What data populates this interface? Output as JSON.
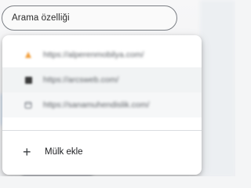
{
  "search": {
    "value": "Arama özelliği"
  },
  "menu": {
    "items": [
      {
        "url": "https://alperenmobilya.com/",
        "icon": "orange-favicon",
        "icon_color": "#f29d38"
      },
      {
        "url": "https://arcsweb.com/",
        "icon": "dark-square-favicon",
        "icon_color": "#3a3a3a"
      },
      {
        "url": "https://sanamuhendislik.com/",
        "icon": "globe-favicon",
        "icon_color": "#8a8f96"
      }
    ],
    "add_label": "Mülk ekle",
    "add_icon": "plus-icon"
  }
}
